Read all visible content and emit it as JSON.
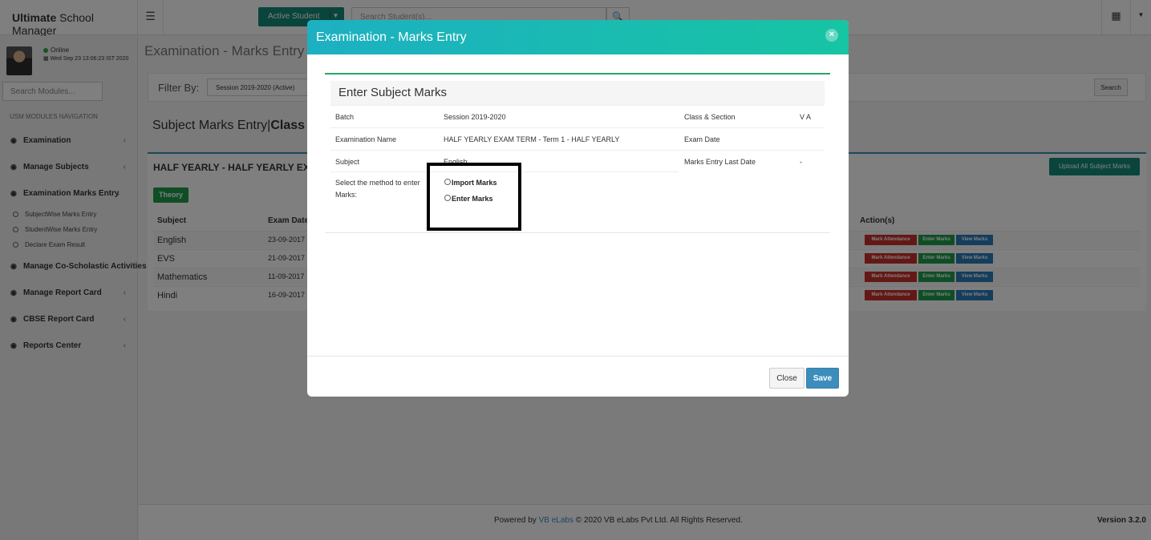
{
  "app": {
    "brand_bold": "Ultimate",
    "brand_rest": " School Manager",
    "active_student_label": "Active Student",
    "search_students_placeholder": "Search Student(s)..."
  },
  "sidebar": {
    "status": "Online",
    "datetime": "Wed Sep 23 13:06:23 IST 2020",
    "module_search_placeholder": "Search Modules...",
    "nav_heading": "USM MODULES NAVIGATION",
    "items": [
      {
        "label": "Examination",
        "icon": "dashboard-icon"
      },
      {
        "label": "Manage Subjects",
        "icon": "dashboard-icon"
      },
      {
        "label": "Examination Marks Entry",
        "icon": "dashboard-icon"
      },
      {
        "label": "Manage Co-Scholastic Activities",
        "icon": "dashboard-icon"
      },
      {
        "label": "Manage Report Card",
        "icon": "dashboard-icon"
      },
      {
        "label": "CBSE Report Card",
        "icon": "dashboard-icon"
      },
      {
        "label": "Reports Center",
        "icon": "dashboard-icon"
      }
    ],
    "sub_items": [
      {
        "label": "SubjectWise Marks Entry"
      },
      {
        "label": "StudentWise Marks Entry"
      },
      {
        "label": "Declare Exam Result"
      }
    ]
  },
  "main": {
    "page_title": "Examination - Marks Entry",
    "filter_label": "Filter By:",
    "filter_value": "Session 2019-2020 (Active)",
    "filter_search": "Search",
    "subject_header_normal": "Subject Marks Entry|",
    "subject_header_bold": "Class",
    "exam_title": "HALF YEARLY - HALF YEARLY EXA",
    "upload_button": "Upload All Subject Marks",
    "theory_tab": "Theory",
    "columns": [
      "Subject",
      "Exam Date",
      "Action(s)"
    ],
    "rows": [
      {
        "subject": "English",
        "date": "23-09-2017"
      },
      {
        "subject": "EVS",
        "date": "21-09-2017"
      },
      {
        "subject": "Mathematics",
        "date": "11-09-2017"
      },
      {
        "subject": "Hindi",
        "date": "16-09-2017"
      }
    ],
    "actions": {
      "attendance": "Mark Attendance",
      "enter": "Enter Marks",
      "view": "View Marks"
    }
  },
  "footer": {
    "powered_by": "Powered by ",
    "company_link": "VB eLabs",
    "copyright": " © 2020 VB eLabs Pvt Ltd. All Rights Reserved.",
    "version": "Version 3.2.0"
  },
  "modal": {
    "title": "Examination - Marks Entry",
    "close_glyph": "×",
    "card_title": "Enter Subject Marks",
    "batch_label": "Batch",
    "batch_value": "Session 2019-2020",
    "class_label": "Class & Section",
    "class_value": "V A",
    "exam_name_label": "Examination Name",
    "exam_name_value": "HALF YEARLY EXAM TERM - Term 1 - HALF YEARLY",
    "exam_date_label": "Exam Date",
    "exam_date_value": "",
    "subject_label": "Subject",
    "subject_value": "English",
    "last_date_label": "Marks Entry Last Date",
    "last_date_value": "-",
    "method_label": "Select the method to enter Marks:",
    "option_import": "Import Marks",
    "option_enter": "Enter Marks",
    "close_button": "Close",
    "save_button": "Save"
  }
}
